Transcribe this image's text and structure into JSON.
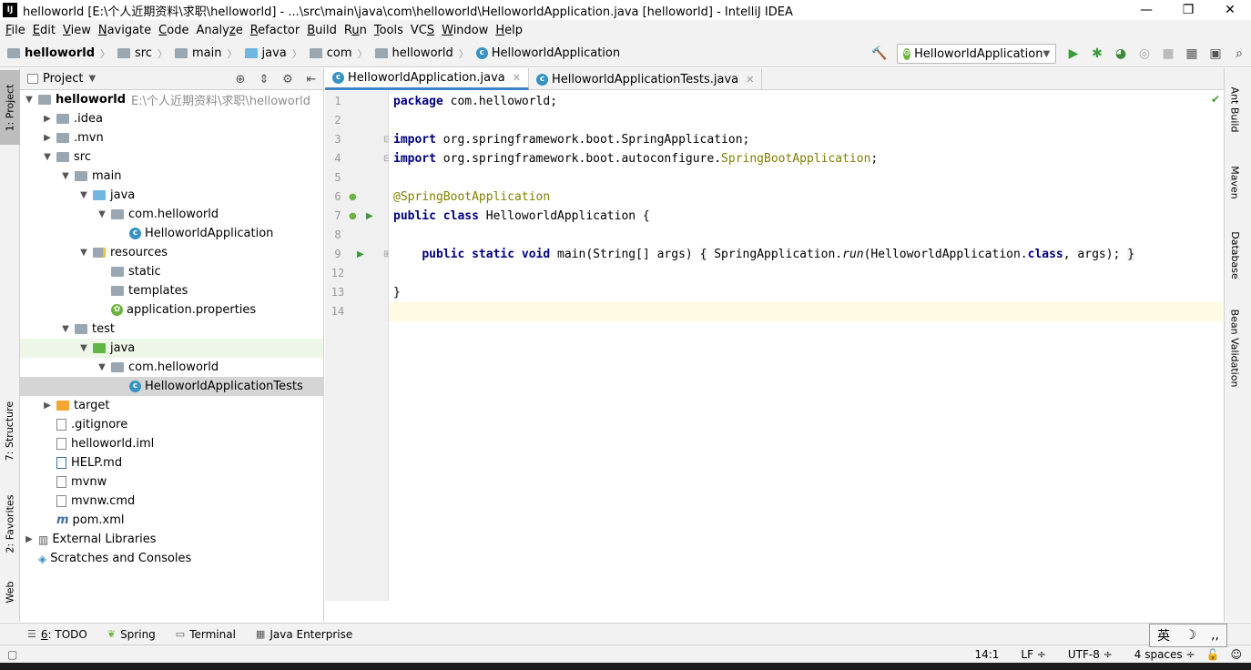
{
  "window": {
    "title": "helloworld [E:\\个人近期资料\\求职\\helloworld] - ...\\src\\main\\java\\com\\helloworld\\HelloworldApplication.java [helloworld] - IntelliJ IDEA",
    "logo": "IJ",
    "minimize": "—",
    "maximize": "❐",
    "close": "✕"
  },
  "menu": [
    {
      "u": "F",
      "rest": "ile"
    },
    {
      "u": "E",
      "rest": "dit"
    },
    {
      "u": "V",
      "rest": "iew"
    },
    {
      "u": "N",
      "rest": "avigate"
    },
    {
      "u": "C",
      "rest": "ode"
    },
    {
      "pre": "Analy",
      "u": "z",
      "rest": "e"
    },
    {
      "u": "R",
      "rest": "efactor"
    },
    {
      "u": "B",
      "rest": "uild"
    },
    {
      "pre": "R",
      "u": "u",
      "rest": "n"
    },
    {
      "u": "T",
      "rest": "ools"
    },
    {
      "pre": "VC",
      "u": "S",
      "rest": ""
    },
    {
      "u": "W",
      "rest": "indow"
    },
    {
      "u": "H",
      "rest": "elp"
    }
  ],
  "breadcrumb": [
    "helloworld",
    "src",
    "main",
    "java",
    "com",
    "helloworld",
    "HelloworldApplication"
  ],
  "run_config": "HelloworldApplication",
  "left_tabs": {
    "project": "1: Project",
    "structure": "7: Structure",
    "favorites": "2: Favorites",
    "web": "Web"
  },
  "right_tabs": {
    "ant": "Ant Build",
    "maven": "Maven",
    "database": "Database",
    "bean": "Bean Validation"
  },
  "project_panel": {
    "title": "Project",
    "root_name": "helloworld",
    "root_path": "E:\\个人近期资料\\求职\\helloworld",
    "items": [
      {
        "label": ".idea"
      },
      {
        "label": ".mvn"
      },
      {
        "label": "src"
      },
      {
        "label": "main"
      },
      {
        "label": "java"
      },
      {
        "label": "com.helloworld"
      },
      {
        "label": "HelloworldApplication"
      },
      {
        "label": "resources"
      },
      {
        "label": "static"
      },
      {
        "label": "templates"
      },
      {
        "label": "application.properties"
      },
      {
        "label": "test"
      },
      {
        "label": "java"
      },
      {
        "label": "com.helloworld"
      },
      {
        "label": "HelloworldApplicationTests"
      },
      {
        "label": "target"
      },
      {
        "label": ".gitignore"
      },
      {
        "label": "helloworld.iml"
      },
      {
        "label": "HELP.md"
      },
      {
        "label": "mvnw"
      },
      {
        "label": "mvnw.cmd"
      },
      {
        "label": "pom.xml"
      },
      {
        "label": "External Libraries"
      },
      {
        "label": "Scratches and Consoles"
      }
    ]
  },
  "editor_tabs": [
    {
      "label": "HelloworldApplication.java"
    },
    {
      "label": "HelloworldApplicationTests.java"
    }
  ],
  "code": {
    "line_numbers": [
      "1",
      "2",
      "3",
      "4",
      "5",
      "6",
      "7",
      "8",
      "9",
      "12",
      "13",
      "14"
    ],
    "l1_kw": "package",
    "l1_rest": " com.helloworld;",
    "l3_kw": "import",
    "l3_rest": " org.springframework.boot.SpringApplication;",
    "l4_kw": "import",
    "l4_rest": " org.springframework.boot.autoconfigure.",
    "l4_ann": "SpringBootApplication",
    "l4_end": ";",
    "l6_ann": "@SpringBootApplication",
    "l7_kw": "public class",
    "l7_rest": " HelloworldApplication {",
    "l9_kw": "public static void",
    "l9_a": " main(String[] args) ",
    "l9_b": "{",
    "l9_c": " SpringApplication.",
    "l9_run": "run",
    "l9_d": "(HelloworldApplication.",
    "l9_kw2": "class",
    "l9_e": ", args); ",
    "l9_f": "}",
    "l13": "}"
  },
  "bottom_tabs": [
    {
      "u": "6",
      "label": ": TODO"
    },
    {
      "label": "Spring"
    },
    {
      "label": "Terminal"
    },
    {
      "label": "Java Enterprise"
    }
  ],
  "status": {
    "position": "14:1",
    "line_sep": "LF",
    "encoding": "UTF-8",
    "indent": "4 spaces"
  },
  "ime": {
    "lang": "英",
    "moon": "☽",
    "punct": "‚‚"
  }
}
